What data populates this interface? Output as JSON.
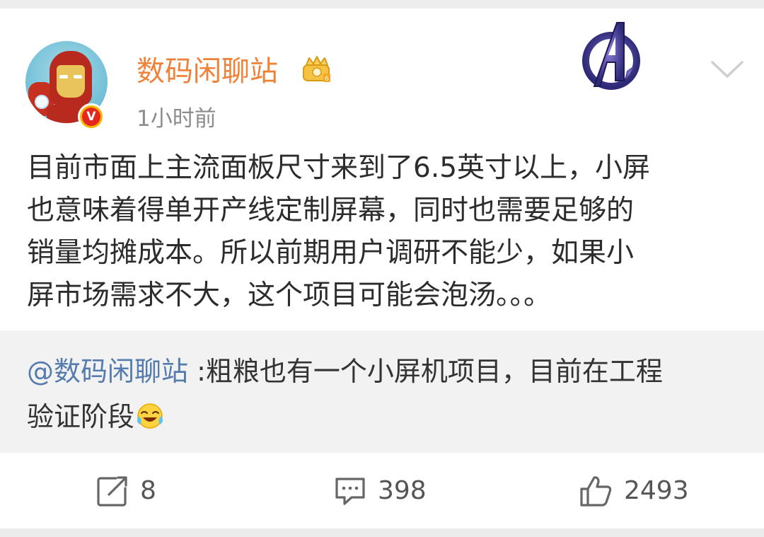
{
  "post": {
    "author": "数码闲聊站",
    "verified_badge": "V",
    "timestamp": "1小时前",
    "icons": [
      "crown-icon",
      "avengers-icon",
      "chevron-down-icon"
    ],
    "text_lines": [
      "目前市面上主流面板尺寸来到了6.5英寸以上，小屏",
      "也意味着得单开产线定制屏幕，同时也需要足够的",
      "销量均摊成本。所以前期用户调研不能少，如果小",
      "屏市场需求不大，这个项目可能会泡汤。。。"
    ]
  },
  "repost": {
    "mention": "@数码闲聊站",
    "line1_rest": " :粗粮也有一个小屏机项目，目前在工程",
    "line2": "验证阶段",
    "emoji": "laugh-cry-icon"
  },
  "actions": {
    "repost_count": "8",
    "comment_count": "398",
    "like_count": "2493"
  },
  "colors": {
    "username": "#ef8239",
    "mention": "#557cad",
    "text": "#2c2c2c",
    "meta": "#8c8c8c",
    "background": "#ececec"
  }
}
